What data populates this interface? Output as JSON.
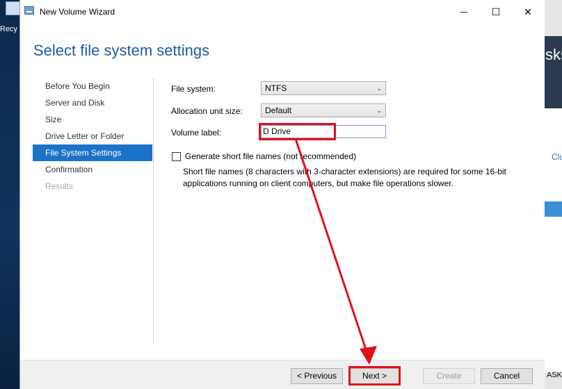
{
  "desktop": {
    "recycle_label": "Recy"
  },
  "background_window": {
    "header_text": "sks",
    "link_text": "Clu",
    "tasks_text": "ASKS"
  },
  "window": {
    "title": "New Volume Wizard",
    "controls": {
      "minimize": "─",
      "maximize": "☐",
      "close": "✕"
    }
  },
  "page_title": "Select file system settings",
  "steps": [
    {
      "label": "Before You Begin",
      "state": "normal"
    },
    {
      "label": "Server and Disk",
      "state": "normal"
    },
    {
      "label": "Size",
      "state": "normal"
    },
    {
      "label": "Drive Letter or Folder",
      "state": "normal"
    },
    {
      "label": "File System Settings",
      "state": "active"
    },
    {
      "label": "Confirmation",
      "state": "normal"
    },
    {
      "label": "Results",
      "state": "disabled"
    }
  ],
  "form": {
    "file_system_label": "File system:",
    "file_system_value": "NTFS",
    "allocation_label": "Allocation unit size:",
    "allocation_value": "Default",
    "volume_label_label": "Volume label:",
    "volume_label_value": "D Drive",
    "short_names_label": "Generate short file names (not recommended)",
    "short_names_checked": false,
    "short_names_description": "Short file names (8 characters with 3-character extensions) are required for some 16-bit applications running on client computers, but make file operations slower."
  },
  "buttons": {
    "previous": "< Previous",
    "next": "Next >",
    "create": "Create",
    "cancel": "Cancel"
  },
  "colors": {
    "accent": "#1a73c7",
    "title": "#1e5aa8",
    "annotation": "#e0101d"
  },
  "icons": {
    "dropdown": "chevron-down-icon",
    "app": "volume-wizard-icon"
  }
}
